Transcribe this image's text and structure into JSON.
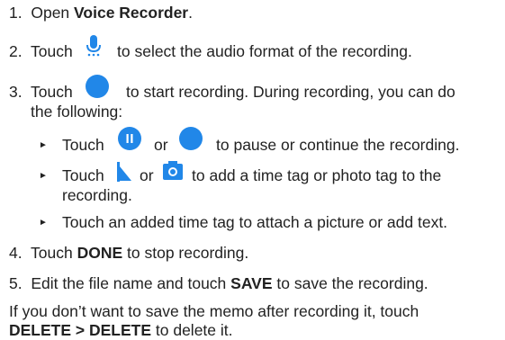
{
  "colors": {
    "text": "#222222",
    "accent": "#2187e8"
  },
  "steps": [
    {
      "num": "1.",
      "pre": "Open ",
      "bold": "Voice Recorder",
      "post": "."
    },
    {
      "num": "2.",
      "pre": "Touch",
      "icon": "microphone-format-icon",
      "post": "to select the audio format of the recording."
    },
    {
      "num": "3.",
      "pre": "Touch",
      "icon": "record-button-icon",
      "post": "to start recording. During recording, you can do",
      "cont": "the following:"
    },
    {
      "num": "4.",
      "pre": "Touch ",
      "bold": "DONE",
      "post": " to stop recording."
    },
    {
      "num": "5.",
      "pre": "Edit the file name and touch ",
      "bold": "SAVE",
      "post": " to save the recording."
    }
  ],
  "sub_bullets": [
    {
      "pre": "Touch",
      "icon1": "pause-icon",
      "mid": "or",
      "icon2": "continue-record-icon",
      "post": "to pause or continue the recording."
    },
    {
      "pre": "Touch",
      "icon1": "time-tag-flag-icon",
      "mid": "or",
      "icon2": "photo-tag-camera-icon",
      "post": "to add a time tag or photo tag to the",
      "cont": "recording."
    },
    {
      "text": "Touch an added time tag to attach a picture or add text."
    }
  ],
  "note": {
    "line1": "If you don’t want to save the memo after recording it, touch",
    "bold": "DELETE > DELETE",
    "post": " to delete it."
  }
}
